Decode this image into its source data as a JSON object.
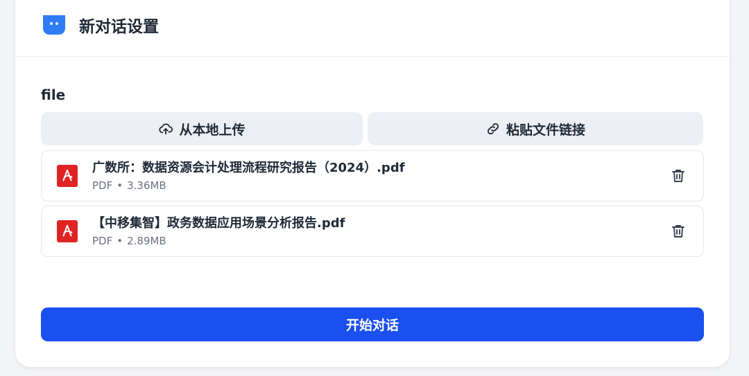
{
  "header": {
    "title": "新对话设置",
    "icon": "chat-bot-icon"
  },
  "section": {
    "label": "file"
  },
  "upload": {
    "local_label": "从本地上传",
    "link_label": "粘贴文件链接"
  },
  "files": [
    {
      "name": "广数所：数据资源会计处理流程研究报告（2024）.pdf",
      "type": "PDF",
      "separator": "•",
      "size": "3.36MB"
    },
    {
      "name": "【中移集智】政务数据应用场景分析报告.pdf",
      "type": "PDF",
      "separator": "•",
      "size": "2.89MB"
    }
  ],
  "actions": {
    "start_label": "开始对话"
  },
  "colors": {
    "primary": "#1a4ff0",
    "app_icon": "#2f7cf6",
    "pdf_red": "#e02424",
    "button_bg": "#eceff4"
  }
}
